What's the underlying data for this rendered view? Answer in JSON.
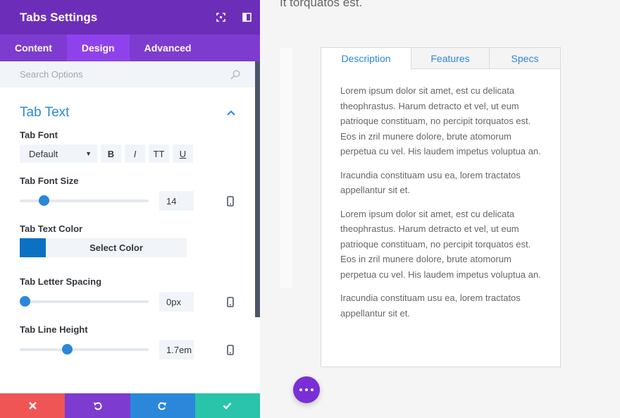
{
  "panel": {
    "title": "Tabs Settings",
    "tabs": [
      {
        "label": "Content"
      },
      {
        "label": "Design"
      },
      {
        "label": "Advanced"
      }
    ],
    "search_placeholder": "Search Options",
    "section_title": "Tab Text",
    "tab_font": {
      "label": "Tab Font",
      "value": "Default",
      "styles": [
        "B",
        "I",
        "TT",
        "U"
      ]
    },
    "font_size": {
      "label": "Tab Font Size",
      "value": "14",
      "level": 0.16
    },
    "text_color": {
      "label": "Tab Text Color",
      "button": "Select Color",
      "color": "#0c71c3"
    },
    "letter_spacing": {
      "label": "Tab Letter Spacing",
      "value": "0px",
      "level": 0.0
    },
    "line_height": {
      "label": "Tab Line Height",
      "value": "1.7em",
      "level": 0.36
    }
  },
  "colors": {
    "header": "#6c2eb9",
    "tabs_bar": "#7e3bd0",
    "accent": "#2b87da",
    "cancel": "#ef5555",
    "undo": "#7e3bd0",
    "redo": "#2b87da",
    "save": "#29c4a9"
  },
  "preview": {
    "top_text": "It torquatos est.",
    "tabs": [
      {
        "label": "Description"
      },
      {
        "label": "Features"
      },
      {
        "label": "Specs"
      }
    ],
    "paragraphs": [
      "Lorem ipsum dolor sit amet, est cu delicata theophrastus. Harum detracto et vel, ut eum patrioque constituam, no percipit torquatos est. Eos in zril munere dolore, brute atomorum perpetua cu vel. His laudem impetus voluptua an.",
      "Iracundia constituam usu ea, lorem tractatos appellantur sit et.",
      "Lorem ipsum dolor sit amet, est cu delicata theophrastus. Harum detracto et vel, ut eum patrioque constituam, no percipit torquatos est. Eos in zril munere dolore, brute atomorum perpetua cu vel. His laudem impetus voluptua an.",
      "Iracundia constituam usu ea, lorem tractatos appellantur sit et."
    ]
  }
}
